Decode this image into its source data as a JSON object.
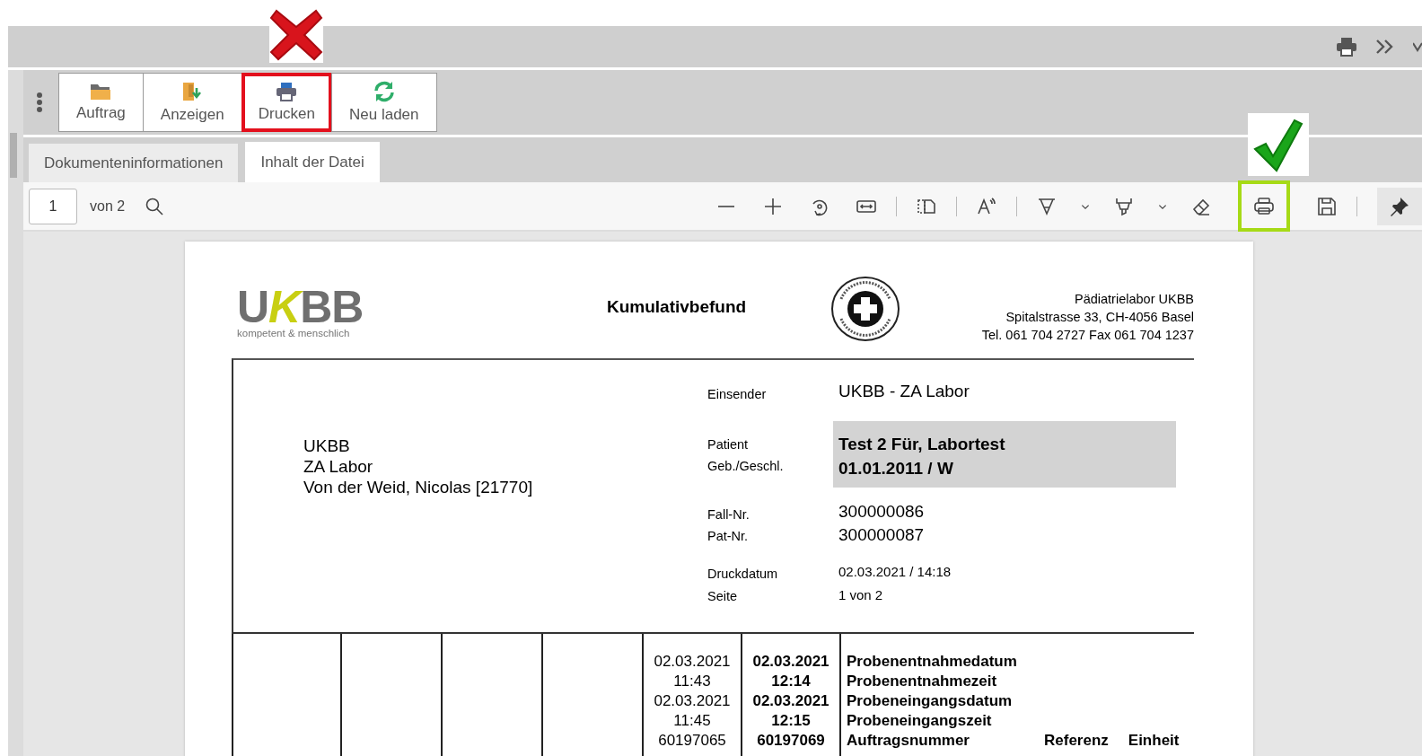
{
  "toolbar": {
    "buttons": [
      {
        "label": "Auftrag",
        "kind": "folder",
        "marked": false
      },
      {
        "label": "Anzeigen",
        "kind": "download",
        "marked": false
      },
      {
        "label": "Drucken",
        "kind": "print",
        "marked": true
      },
      {
        "label": "Neu laden",
        "kind": "reload",
        "marked": false
      }
    ]
  },
  "tabs": [
    {
      "label": "Dokumenteninformationen",
      "selected": false
    },
    {
      "label": "Inhalt der Datei",
      "selected": true
    }
  ],
  "viewer": {
    "page_number": "1",
    "page_count": "von 2",
    "print_marked": true
  },
  "document": {
    "logo_text": "UKBB",
    "logo_tagline": "kompetent & menschlich",
    "title": "Kumulativbefund",
    "lab_address": [
      "Pädiatrielabor UKBB",
      "Spitalstrasse 33, CH-4056 Basel",
      "Tel. 061 704 2727 Fax 061 704 1237"
    ],
    "recipient": [
      "UKBB",
      "ZA Labor",
      "Von der Weid, Nicolas [21770]"
    ],
    "fields": [
      {
        "label": "Einsender",
        "value": "UKBB - ZA Labor",
        "kind": "large"
      },
      {
        "label": "Patient",
        "value": "Test 2 Für, Labortest",
        "kind": "highlight"
      },
      {
        "label": "Geb./Geschl.",
        "value": "01.01.2011 / W",
        "kind": "highlight"
      },
      {
        "label": "Fall-Nr.",
        "value": "300000086",
        "kind": "large"
      },
      {
        "label": "Pat-Nr.",
        "value": "300000087",
        "kind": "large"
      },
      {
        "label": "Druckdatum",
        "value": "02.03.2021 / 14:18",
        "kind": "small"
      },
      {
        "label": "Seite",
        "value": "1 von 2",
        "kind": "small"
      }
    ],
    "table": {
      "rows": [
        {
          "column_5": "02.03.2021",
          "column_6": "02.03.2021",
          "label": "Probenentnahmedatum"
        },
        {
          "column_5": "11:43",
          "column_6": "12:14",
          "label": "Probenentnahmezeit"
        },
        {
          "column_5": "02.03.2021",
          "column_6": "02.03.2021",
          "label": "Probeneingangsdatum"
        },
        {
          "column_5": "11:45",
          "column_6": "12:15",
          "label": "Probeneingangszeit"
        },
        {
          "column_5": "60197065",
          "column_6": "60197069",
          "label": "Auftragsnummer",
          "reference": "Referenz",
          "unit": "Einheit"
        }
      ]
    }
  }
}
